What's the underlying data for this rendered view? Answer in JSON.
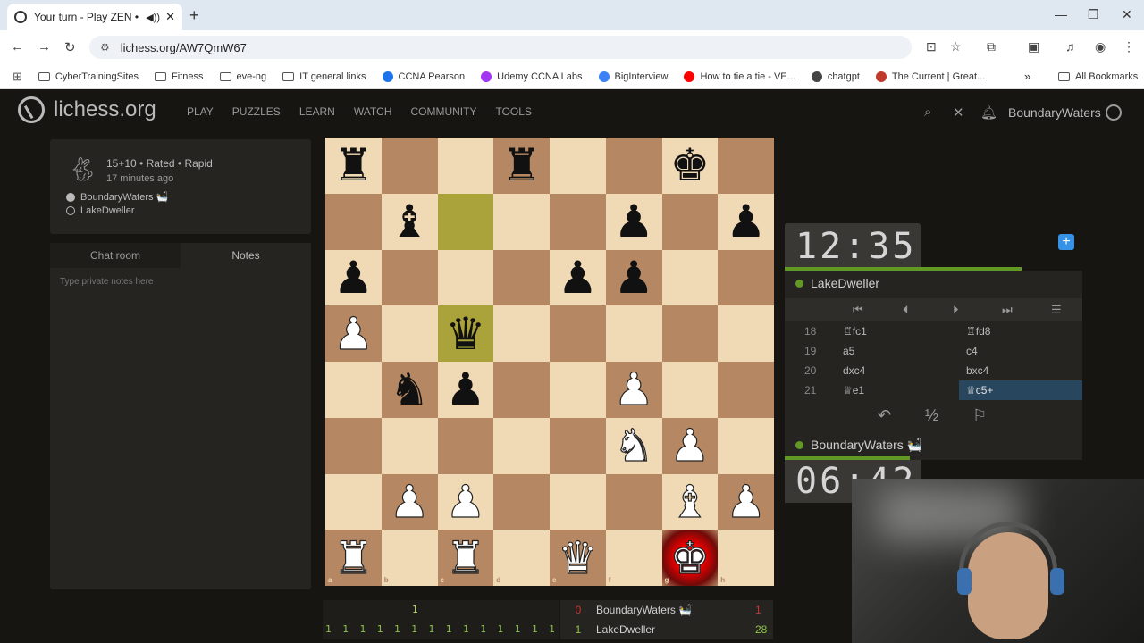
{
  "browser": {
    "tab_title": "Your turn - Play ZEN • liche",
    "new_tab": "+",
    "url": "lichess.org/AW7QmW67",
    "bookmarks": [
      {
        "label": "CyberTrainingSites",
        "type": "folder"
      },
      {
        "label": "Fitness",
        "type": "folder"
      },
      {
        "label": "eve-ng",
        "type": "folder"
      },
      {
        "label": "IT general links",
        "type": "folder"
      },
      {
        "label": "CCNA Pearson",
        "type": "site",
        "color": "#1a73e8"
      },
      {
        "label": "Udemy CCNA Labs",
        "type": "site",
        "color": "#a435f0"
      },
      {
        "label": "BigInterview",
        "type": "site",
        "color": "#3b82f6"
      },
      {
        "label": "How to tie a tie - VE...",
        "type": "site",
        "color": "#ff0000"
      },
      {
        "label": "chatgpt",
        "type": "site",
        "color": "#444444"
      },
      {
        "label": "The Current | Great...",
        "type": "site",
        "color": "#c0392b"
      }
    ],
    "all_bookmarks": "All Bookmarks",
    "more": "»"
  },
  "header": {
    "logo": "lichess.org",
    "nav": [
      "PLAY",
      "PUZZLES",
      "LEARN",
      "WATCH",
      "COMMUNITY",
      "TOOLS"
    ],
    "username": "BoundaryWaters"
  },
  "game": {
    "type": "15+10 • Rated • Rapid",
    "time_ago": "17 minutes ago",
    "white": "BoundaryWaters 🛀",
    "black": "LakeDweller"
  },
  "notes": {
    "tabs": [
      "Chat room",
      "Notes"
    ],
    "placeholder": "Type private notes here"
  },
  "board": {
    "ranks": [
      "r . . r . . k .",
      ". b . . . p . p",
      "p . . . p p . .",
      "P . q . . . . .",
      ". n p . . P . .",
      ". . . . . N P .",
      ". P P . . . B P",
      "R . R . Q . K ."
    ],
    "highlight_squares": [
      "c7",
      "c5"
    ],
    "check_square": "g1",
    "files": [
      "a",
      "b",
      "c",
      "d",
      "e",
      "f",
      "g",
      "h"
    ],
    "rank_labels": [
      "8",
      "7",
      "6",
      "5",
      "4",
      "3",
      "2",
      "1"
    ]
  },
  "clocks": {
    "opponent_time": "12:35",
    "player_time": "06:42",
    "opponent_name": "LakeDweller",
    "player_name": "BoundaryWaters 🛀"
  },
  "moves": [
    {
      "n": "18",
      "w": "♖fc1",
      "b": "♖fd8"
    },
    {
      "n": "19",
      "w": "a5",
      "b": "c4"
    },
    {
      "n": "20",
      "w": "dxc4",
      "b": "bxc4"
    },
    {
      "n": "21",
      "w": "♕e1",
      "b": "♕c5+"
    }
  ],
  "actions": {
    "takeback": "↶",
    "draw": "½",
    "resign": "⚐"
  },
  "strip": {
    "top_row": "1",
    "bottom_row": "1 1 1 1 1 1 1   1 1 1 1 1 1 1 1 1 1 1 1",
    "white_name": "BoundaryWaters 🛀",
    "black_name": "LakeDweller",
    "white_score": "0",
    "white_points": "1",
    "black_score": "1",
    "black_points": "28"
  }
}
